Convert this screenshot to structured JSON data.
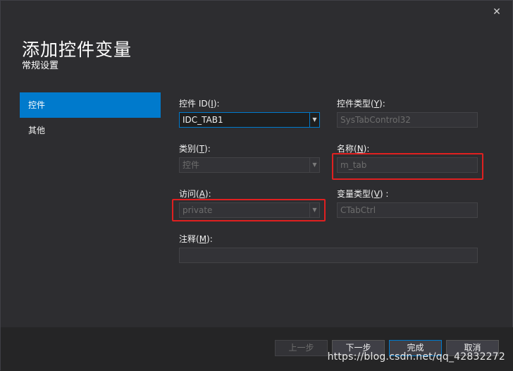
{
  "dialog": {
    "close_glyph": "✕",
    "title": "添加控件变量",
    "subtitle": "常规设置"
  },
  "nav": [
    {
      "label": "控件",
      "active": true
    },
    {
      "label": "其他",
      "active": false
    }
  ],
  "form": {
    "control_id": {
      "label_pre": "控件 ID(",
      "accel": "I",
      "label_post": "):",
      "value": "IDC_TAB1",
      "enabled": true
    },
    "control_type": {
      "label_pre": "控件类型(",
      "accel": "Y",
      "label_post": "):",
      "value": "SysTabControl32",
      "enabled": false
    },
    "category": {
      "label_pre": "类别(",
      "accel": "T",
      "label_post": "):",
      "value": "控件",
      "enabled": false
    },
    "name": {
      "label_pre": "名称(",
      "accel": "N",
      "label_post": "):",
      "value": "m_tab",
      "enabled": false
    },
    "access": {
      "label_pre": "访问(",
      "accel": "A",
      "label_post": "):",
      "value": "private",
      "enabled": false
    },
    "variable_type": {
      "label_pre": "变量类型(",
      "accel": "V",
      "label_post": ") :",
      "value": "CTabCtrl",
      "enabled": false
    },
    "comment": {
      "label_pre": "注释(",
      "accel": "M",
      "label_post": "):",
      "value": "",
      "enabled": false
    }
  },
  "buttons": {
    "prev": "上一步",
    "next": "下一步",
    "finish": "完成",
    "cancel": "取消"
  },
  "watermark": "https://blog.csdn.net/qq_42832272",
  "colors": {
    "background": "#2d2d30",
    "accent": "#007acc",
    "highlight": "#e02020"
  }
}
